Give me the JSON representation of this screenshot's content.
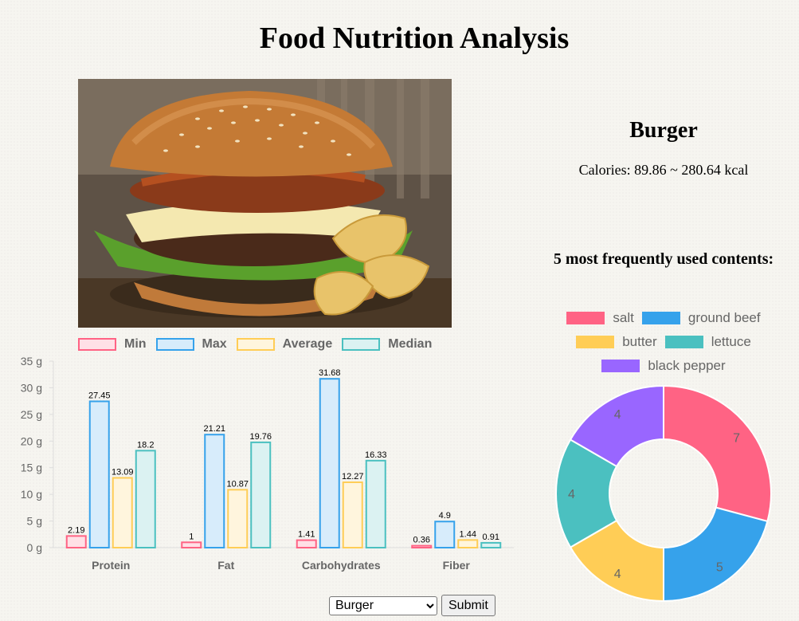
{
  "page_title": "Food Nutrition Analysis",
  "food": {
    "name": "Burger",
    "calories": "Calories: 89.86 ~ 280.64 kcal"
  },
  "freq_title": "5 most frequently used contents:",
  "controls": {
    "selected": "Burger",
    "submit_label": "Submit"
  },
  "chart_data": [
    {
      "type": "bar",
      "categories": [
        "Protein",
        "Fat",
        "Carbohydrates",
        "Fiber"
      ],
      "series": [
        {
          "name": "Min",
          "values": [
            2.19,
            1,
            1.41,
            0.36
          ],
          "color": "#ff6384",
          "fill": "#ffe0e6"
        },
        {
          "name": "Max",
          "values": [
            27.45,
            21.21,
            31.68,
            4.9
          ],
          "color": "#36a2eb",
          "fill": "#d7ecfb"
        },
        {
          "name": "Average",
          "values": [
            13.09,
            10.87,
            12.27,
            1.44
          ],
          "color": "#ffcd56",
          "fill": "#fff5dd"
        },
        {
          "name": "Median",
          "values": [
            18.2,
            19.76,
            16.33,
            0.91
          ],
          "color": "#4bc0c0",
          "fill": "#dbf2f2"
        }
      ],
      "y_ticks": [
        "0 g",
        "5 g",
        "10 g",
        "15 g",
        "20 g",
        "25 g",
        "30 g",
        "35 g"
      ],
      "ylim": [
        0,
        35
      ],
      "title": "",
      "xlabel": "",
      "ylabel": "",
      "legend_position": "top"
    },
    {
      "type": "pie",
      "labels": [
        "salt",
        "ground beef",
        "butter",
        "lettuce",
        "black pepper"
      ],
      "values": [
        7,
        5,
        4,
        4,
        4
      ],
      "colors": [
        "#ff6384",
        "#36a2eb",
        "#ffcd56",
        "#4bc0c0",
        "#9966ff"
      ],
      "legend_position": "top"
    }
  ]
}
